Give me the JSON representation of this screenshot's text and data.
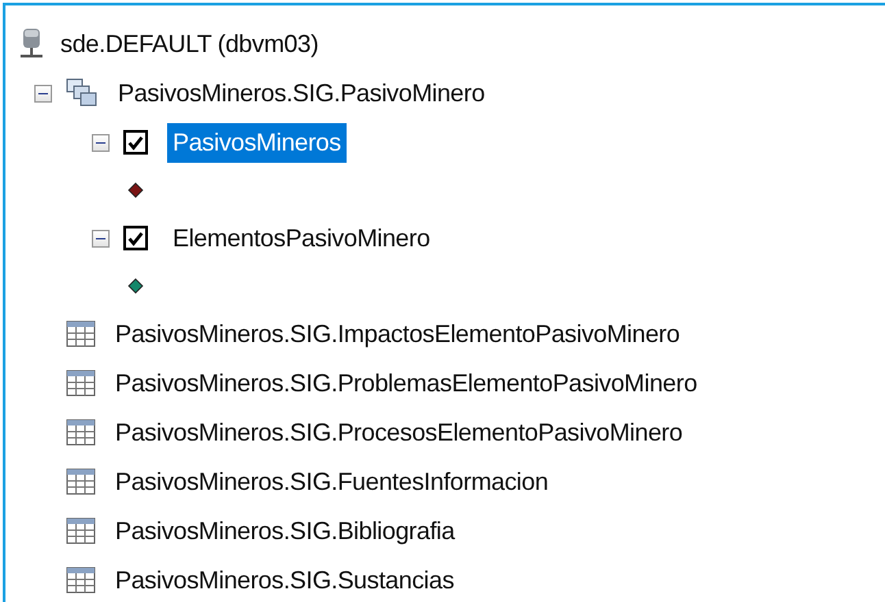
{
  "tree": [
    {
      "kind": "database",
      "label": "sde.DEFAULT (dbvm03)"
    },
    {
      "kind": "topology",
      "label": "PasivosMineros.SIG.PasivoMinero",
      "expanded": true,
      "children": [
        {
          "kind": "layer",
          "label": "PasivosMineros",
          "expanded": true,
          "checked": true,
          "selected": true,
          "children": [
            {
              "kind": "symbol",
              "color": "#7a1414"
            }
          ]
        },
        {
          "kind": "layer",
          "label": "ElementosPasivoMinero",
          "expanded": true,
          "checked": true,
          "selected": false,
          "children": [
            {
              "kind": "symbol",
              "color": "#14876a"
            }
          ]
        }
      ]
    },
    {
      "kind": "table",
      "label": "PasivosMineros.SIG.ImpactosElementoPasivoMinero"
    },
    {
      "kind": "table",
      "label": "PasivosMineros.SIG.ProblemasElementoPasivoMinero"
    },
    {
      "kind": "table",
      "label": "PasivosMineros.SIG.ProcesosElementoPasivoMinero"
    },
    {
      "kind": "table",
      "label": "PasivosMineros.SIG.FuentesInformacion"
    },
    {
      "kind": "table",
      "label": "PasivosMineros.SIG.Bibliografia"
    },
    {
      "kind": "table",
      "label": "PasivosMineros.SIG.Sustancias"
    }
  ]
}
